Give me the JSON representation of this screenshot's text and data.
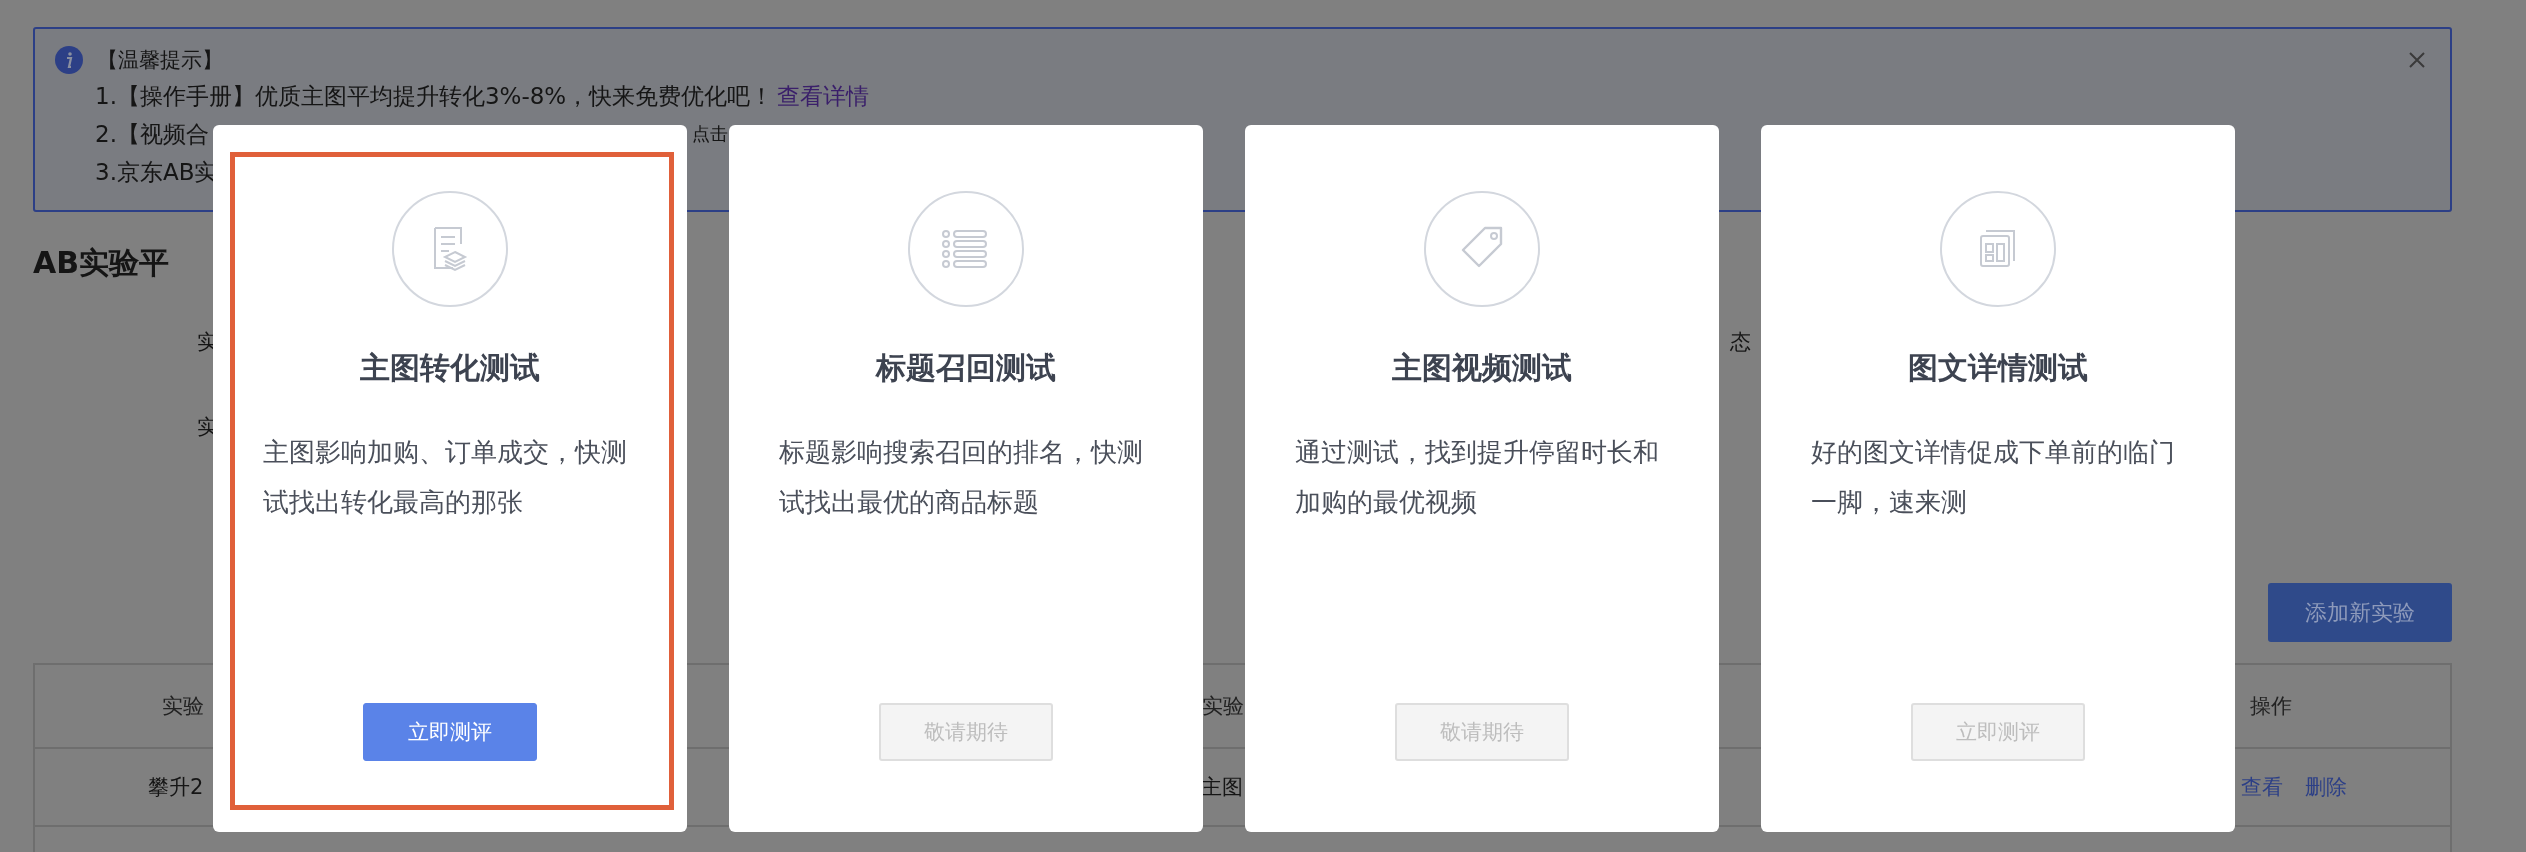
{
  "notice": {
    "title": "【温馨提示】",
    "lines": [
      {
        "text": "1.【操作手册】优质主图平均提升转化3%-8%，快来免费优化吧！",
        "link": "查看详情"
      },
      {
        "text": "2.【视频合",
        "tail": "点击"
      },
      {
        "text": "3.京东AB实"
      }
    ]
  },
  "page_title": "AB实验平",
  "filters": [
    {
      "label": "实",
      "right_label": "态"
    },
    {
      "label": "实"
    }
  ],
  "add_button": "添加新实验",
  "table": {
    "header": [
      "实验",
      "实验",
      "操作"
    ],
    "row": {
      "cells": [
        "攀升2",
        "主图"
      ],
      "actions": [
        "查看",
        "删除"
      ]
    }
  },
  "cards": [
    {
      "kind": "document",
      "title": "主图转化测试",
      "description": "主图影响加购、订单成交，快测试找出转化最高的那张",
      "button": "立即测评",
      "button_disabled": false,
      "selected": true
    },
    {
      "kind": "list",
      "title": "标题召回测试",
      "description": "标题影响搜索召回的排名，快测试找出最优的商品标题",
      "button": "敬请期待",
      "button_disabled": true,
      "selected": false
    },
    {
      "kind": "tag",
      "title": "主图视频测试",
      "description": "通过测试，找到提升停留时长和加购的最优视频",
      "button": "敬请期待",
      "button_disabled": true,
      "selected": false
    },
    {
      "kind": "gallery",
      "title": "图文详情测试",
      "description": "好的图文详情促成下单前的临门一脚，速来测",
      "button": "立即测评",
      "button_disabled": true,
      "selected": false
    }
  ]
}
